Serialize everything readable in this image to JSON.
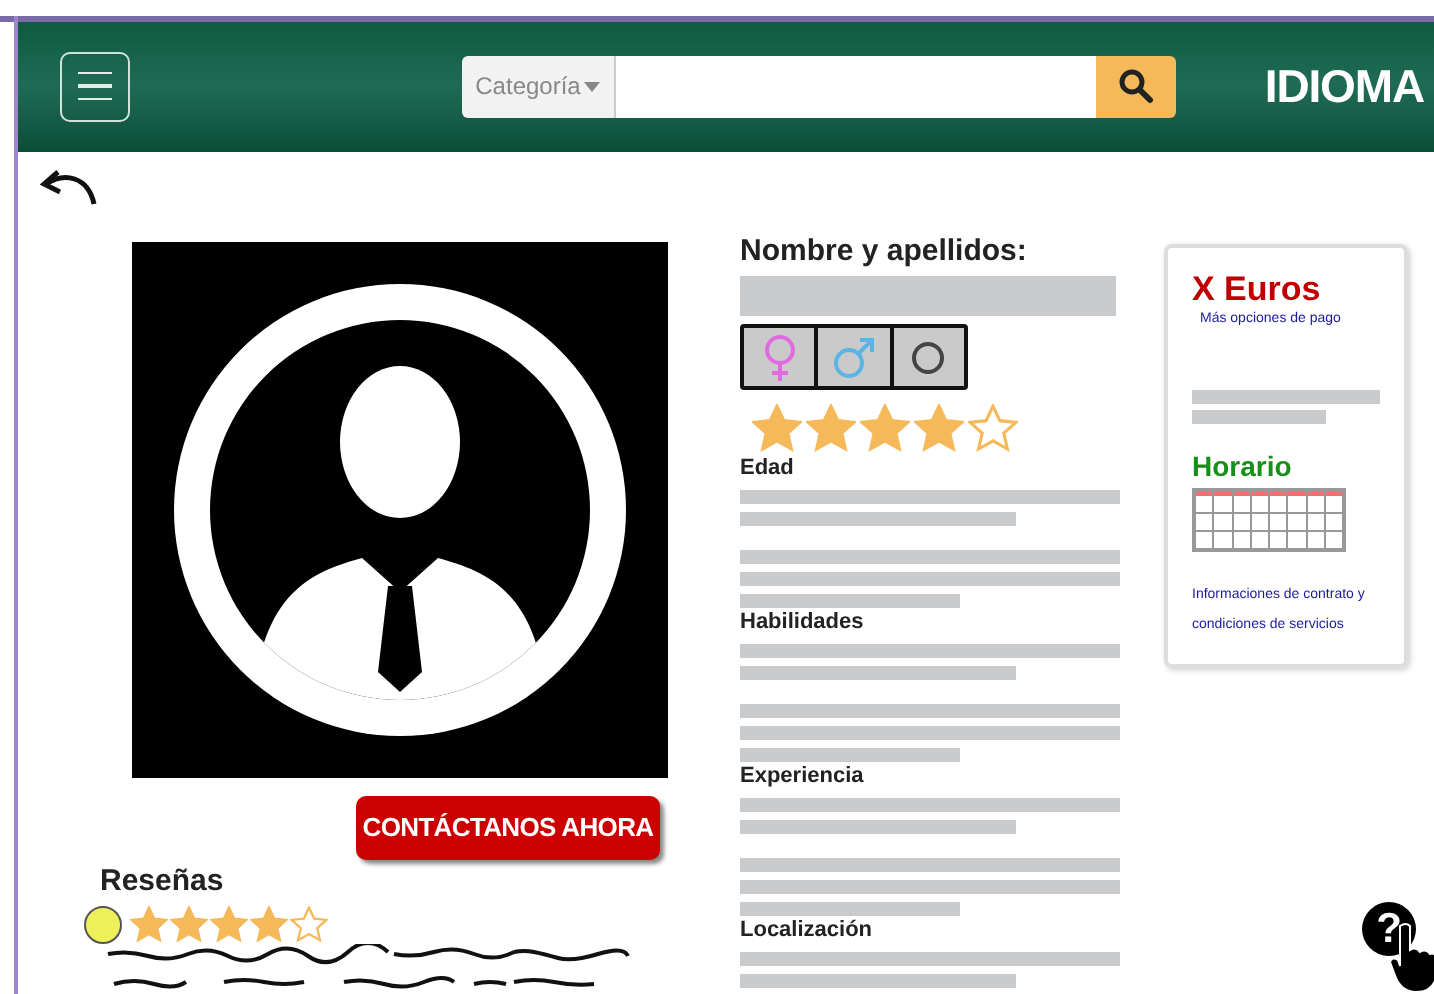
{
  "header": {
    "search": {
      "category": "Categoría"
    },
    "title": "IDIOMA"
  },
  "profile": {
    "name_label": "Nombre y apellidos:",
    "gender_options": [
      {
        "kind": "female"
      },
      {
        "kind": "male"
      },
      {
        "kind": "other"
      }
    ],
    "stars": 4,
    "sections": [
      {
        "label": "Edad"
      },
      {
        "label": "Habilidades"
      },
      {
        "label": "Experiencia"
      },
      {
        "label": "Localización"
      }
    ]
  },
  "contact_button": "CONTÁCTANOS AHORA",
  "reviews": {
    "title": "Reseñas",
    "stars": 4
  },
  "price_card": {
    "price": "X Euros",
    "payment_link": "Más opciones de pago",
    "schedule_title": "Horario",
    "contract_link": "Informaciones de contrato y condiciones de servicios"
  },
  "help_icon": "?"
}
